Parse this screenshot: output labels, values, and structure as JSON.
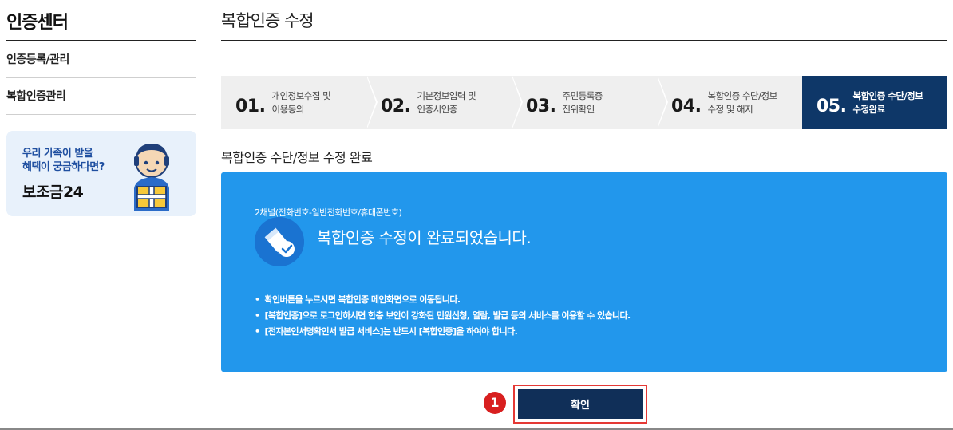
{
  "sidebar": {
    "title": "인증센터",
    "items": [
      {
        "label": "인증등록/관리"
      },
      {
        "label": "복합인증관리"
      }
    ],
    "banner": {
      "line1": "우리 가족이 받을",
      "line2": "혜택이 궁금하다면?",
      "brand": "보조금24"
    }
  },
  "main": {
    "title": "복합인증 수정",
    "steps": [
      {
        "num": "01.",
        "line1": "개인정보수집 및",
        "line2": "이용동의",
        "active": false
      },
      {
        "num": "02.",
        "line1": "기본정보입력 및",
        "line2": "인증서인증",
        "active": false
      },
      {
        "num": "03.",
        "line1": "주민등록증",
        "line2": "진위확인",
        "active": false
      },
      {
        "num": "04.",
        "line1": "복합인증 수단/정보",
        "line2": "수정 및 해지",
        "active": false
      },
      {
        "num": "05.",
        "line1": "복합인증 수단/정보",
        "line2": "수정완료",
        "active": true
      }
    ],
    "section_title": "복합인증 수단/정보 수정 완료",
    "panel": {
      "channel": "2채널(전화번호-일반전화번호/휴대폰번호)",
      "message": "복합인증 수정이 완료되었습니다.",
      "notes": [
        "확인버튼을 누르시면 복합인증 메인화면으로 이동됩니다.",
        "[복합인증]으로 로그인하시면 한층 보안이 강화된 민원신청, 열람, 발급 등의 서비스를 이용할 수 있습니다.",
        "[전자본인서명확인서 발급 서비스]는 반드시 [복합인증]을 하여야 합니다."
      ]
    },
    "confirm_label": "확인",
    "marker": "1"
  },
  "colors": {
    "panel_blue": "#2297ec",
    "active_step": "#0e3768",
    "button": "#102f58",
    "highlight": "#e53935"
  },
  "icons": {
    "panel": "pen-check-icon",
    "banner": "person-with-gift-icon"
  }
}
